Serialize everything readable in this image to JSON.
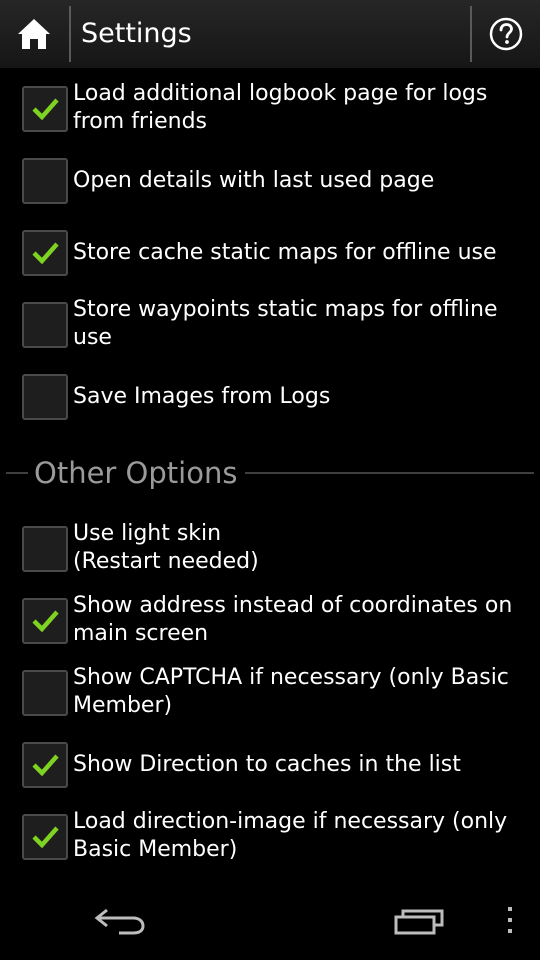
{
  "header": {
    "title": "Settings",
    "home_icon": "home-icon",
    "help_icon": "help-circle-icon"
  },
  "options_top": [
    {
      "label_lines": [
        "Load additional logbook page for logs",
        "from friends"
      ],
      "checked": true
    },
    {
      "label_lines": [
        "Open details with last used page"
      ],
      "checked": false
    },
    {
      "label_lines": [
        "Store cache static maps for offline use"
      ],
      "checked": true
    },
    {
      "label_lines": [
        "Store waypoints static maps for offline",
        "use"
      ],
      "checked": false
    },
    {
      "label_lines": [
        "Save Images from Logs"
      ],
      "checked": false
    }
  ],
  "section": {
    "title": "Other Options"
  },
  "options_other": [
    {
      "label_lines": [
        "Use light skin",
        "(Restart needed)"
      ],
      "checked": false
    },
    {
      "label_lines": [
        "Show address instead of coordinates on",
        "main screen"
      ],
      "checked": true
    },
    {
      "label_lines": [
        "Show CAPTCHA if necessary (only Basic",
        "Member)"
      ],
      "checked": false
    },
    {
      "label_lines": [
        "Show Direction to caches in the list"
      ],
      "checked": true
    },
    {
      "label_lines": [
        "Load direction-image if necessary (only",
        "Basic Member)"
      ],
      "checked": true
    }
  ],
  "navbar": {
    "back_icon": "back-arrow-icon",
    "recent_icon": "recent-apps-icon",
    "menu_icon": "overflow-menu-icon"
  },
  "colors": {
    "check": "#7ed321",
    "background": "#000000",
    "section_text": "#9a9a9a"
  }
}
